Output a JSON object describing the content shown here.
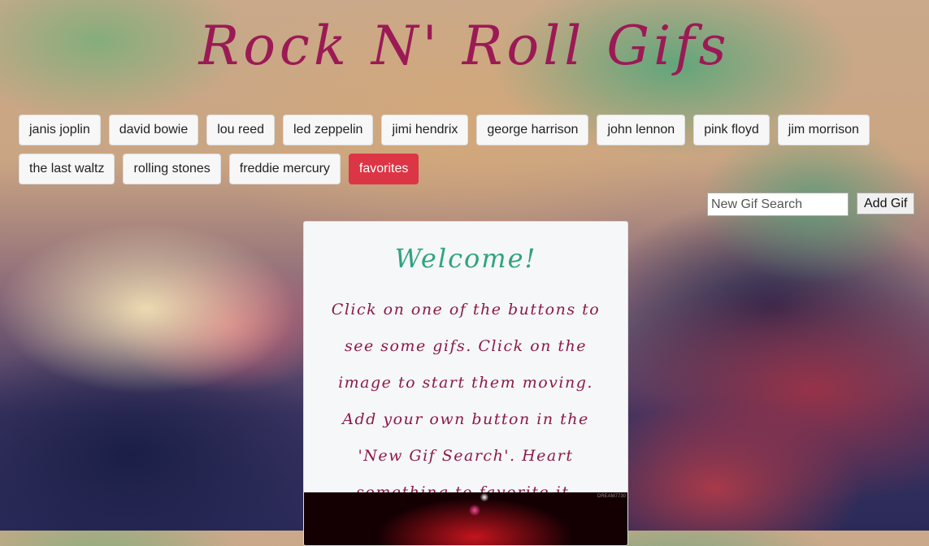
{
  "header": {
    "title": "Rock N' Roll Gifs"
  },
  "buttons": [
    {
      "label": "janis joplin"
    },
    {
      "label": "david bowie"
    },
    {
      "label": "lou reed"
    },
    {
      "label": "led zeppelin"
    },
    {
      "label": "jimi hendrix"
    },
    {
      "label": "george harrison"
    },
    {
      "label": "john lennon"
    },
    {
      "label": "pink floyd"
    },
    {
      "label": "jim morrison"
    },
    {
      "label": "the last waltz"
    },
    {
      "label": "rolling stones"
    },
    {
      "label": "freddie mercury"
    },
    {
      "label": "favorites"
    }
  ],
  "search": {
    "placeholder": "New Gif Search",
    "button_label": "Add Gif"
  },
  "welcome": {
    "title": "Welcome!",
    "message": "Click on one of the buttons to see some gifs. Click on the image to start them moving. Add your own button in the 'New Gif Search'. Heart something to favorite it.",
    "gif_watermark": "DREAM7730"
  },
  "colors": {
    "title": "#9b1a55",
    "welcome_title": "#2fa381",
    "welcome_text": "#8b1a4a",
    "favorites_button": "#dc3545"
  }
}
